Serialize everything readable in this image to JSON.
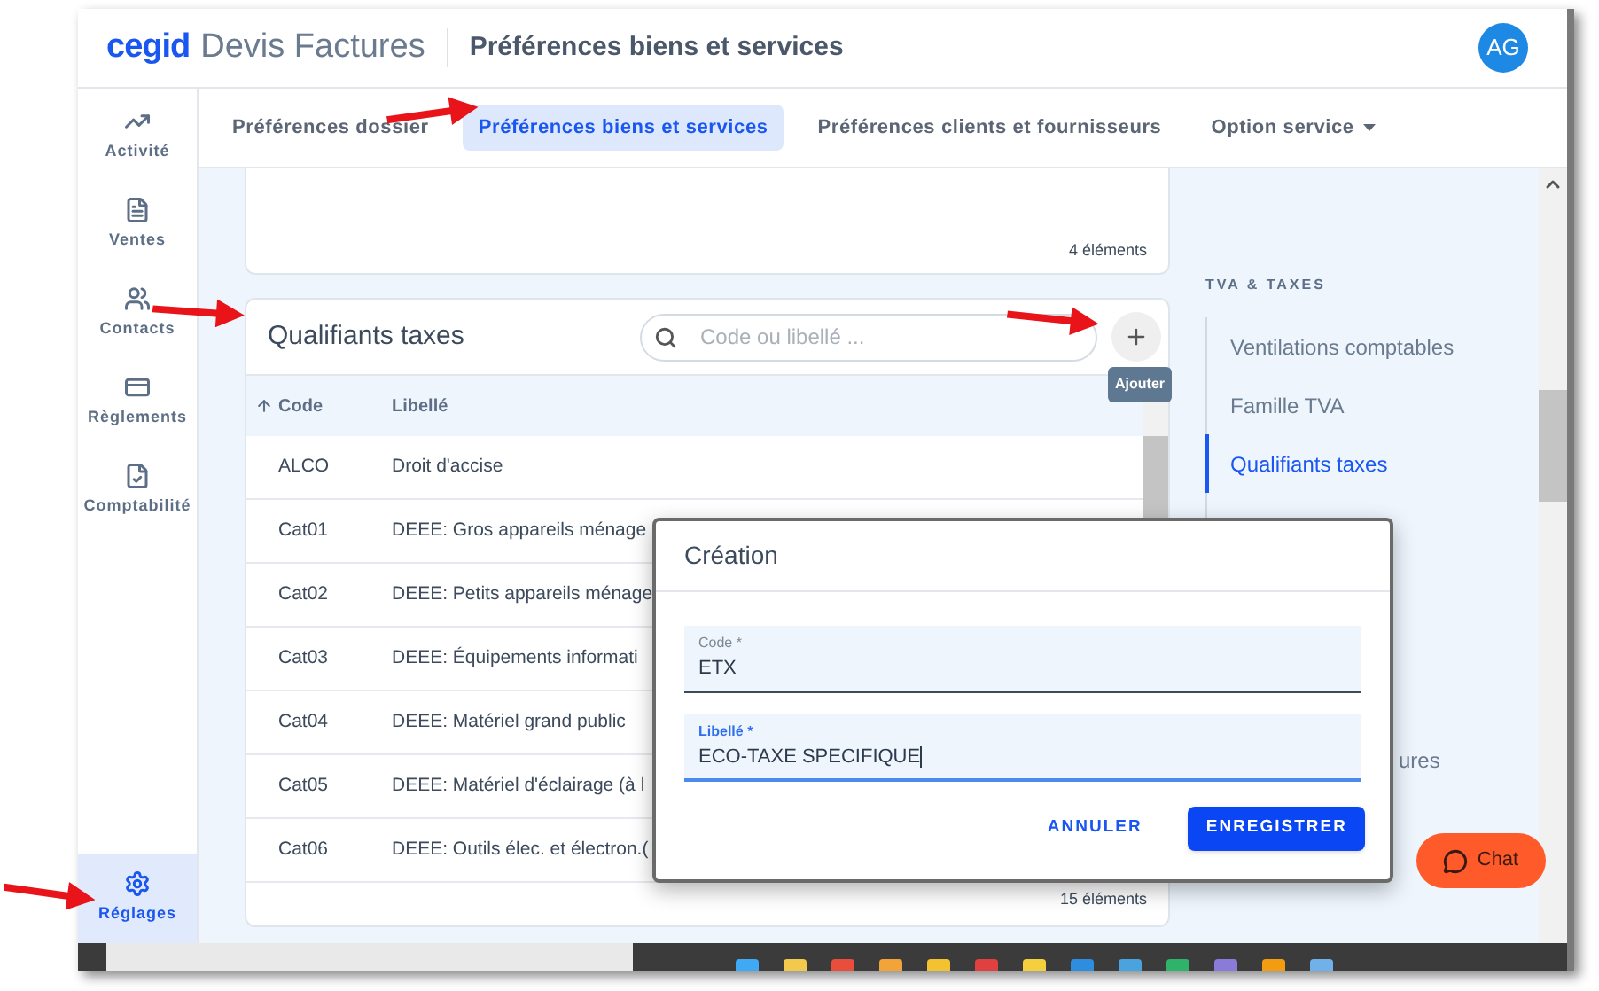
{
  "app": {
    "brand": "cegid",
    "product": "Devis Factures",
    "page_title": "Préférences biens et services",
    "avatar": "AG"
  },
  "sidebar": {
    "items": [
      {
        "label": "Activité",
        "kind": "activity",
        "selected": false
      },
      {
        "label": "Ventes",
        "kind": "sales",
        "selected": false
      },
      {
        "label": "Contacts",
        "kind": "contacts",
        "selected": false
      },
      {
        "label": "Règlements",
        "kind": "payments",
        "selected": false
      },
      {
        "label": "Comptabilité",
        "kind": "accounting",
        "selected": false
      }
    ],
    "bottom_item": {
      "label": "Réglages",
      "kind": "settings",
      "selected": true
    }
  },
  "tabs": [
    {
      "label": "Préférences dossier",
      "selected": false,
      "dropdown": false
    },
    {
      "label": "Préférences biens et services",
      "selected": true,
      "dropdown": false
    },
    {
      "label": "Préférences clients et fournisseurs",
      "selected": false,
      "dropdown": false
    },
    {
      "label": "Option service",
      "selected": false,
      "dropdown": true
    }
  ],
  "top_card": {
    "count": "4 éléments"
  },
  "table_card": {
    "title": "Qualifiants taxes",
    "search": {
      "placeholder": "Code ou libellé ..."
    },
    "add_button": {
      "tooltip": "Ajouter"
    },
    "columns": [
      {
        "label": "Code",
        "sorted": true
      },
      {
        "label": "Libellé",
        "sorted": false
      }
    ],
    "rows": [
      {
        "code": "ALCO",
        "label": "Droit d'accise"
      },
      {
        "code": "Cat01",
        "label": "DEEE: Gros appareils ménage"
      },
      {
        "code": "Cat02",
        "label": "DEEE: Petits appareils ménage"
      },
      {
        "code": "Cat03",
        "label": "DEEE: Équipements informati"
      },
      {
        "code": "Cat04",
        "label": "DEEE: Matériel grand public"
      },
      {
        "code": "Cat05",
        "label": "DEEE: Matériel d'éclairage (à l"
      },
      {
        "code": "Cat06",
        "label": "DEEE: Outils élec. et électron.("
      }
    ],
    "count": "15 éléments"
  },
  "side_nav": {
    "heading": "TVA & TAXES",
    "items": [
      {
        "label": "Ventilations comptables",
        "selected": false
      },
      {
        "label": "Famille TVA",
        "selected": false
      },
      {
        "label": "Qualifiants taxes",
        "selected": true
      }
    ],
    "partly_covered_item": "ures"
  },
  "dialog": {
    "title": "Création",
    "fields": [
      {
        "label": "Code *",
        "value": "ETX",
        "focused": false
      },
      {
        "label": "Libellé *",
        "value": "ECO-TAXE SPECIFIQUE",
        "focused": true
      }
    ],
    "buttons": [
      {
        "label": "ANNULER",
        "kind": "text"
      },
      {
        "label": "ENREGISTRER",
        "kind": "primary"
      }
    ]
  },
  "chat": {
    "label": "Chat"
  }
}
